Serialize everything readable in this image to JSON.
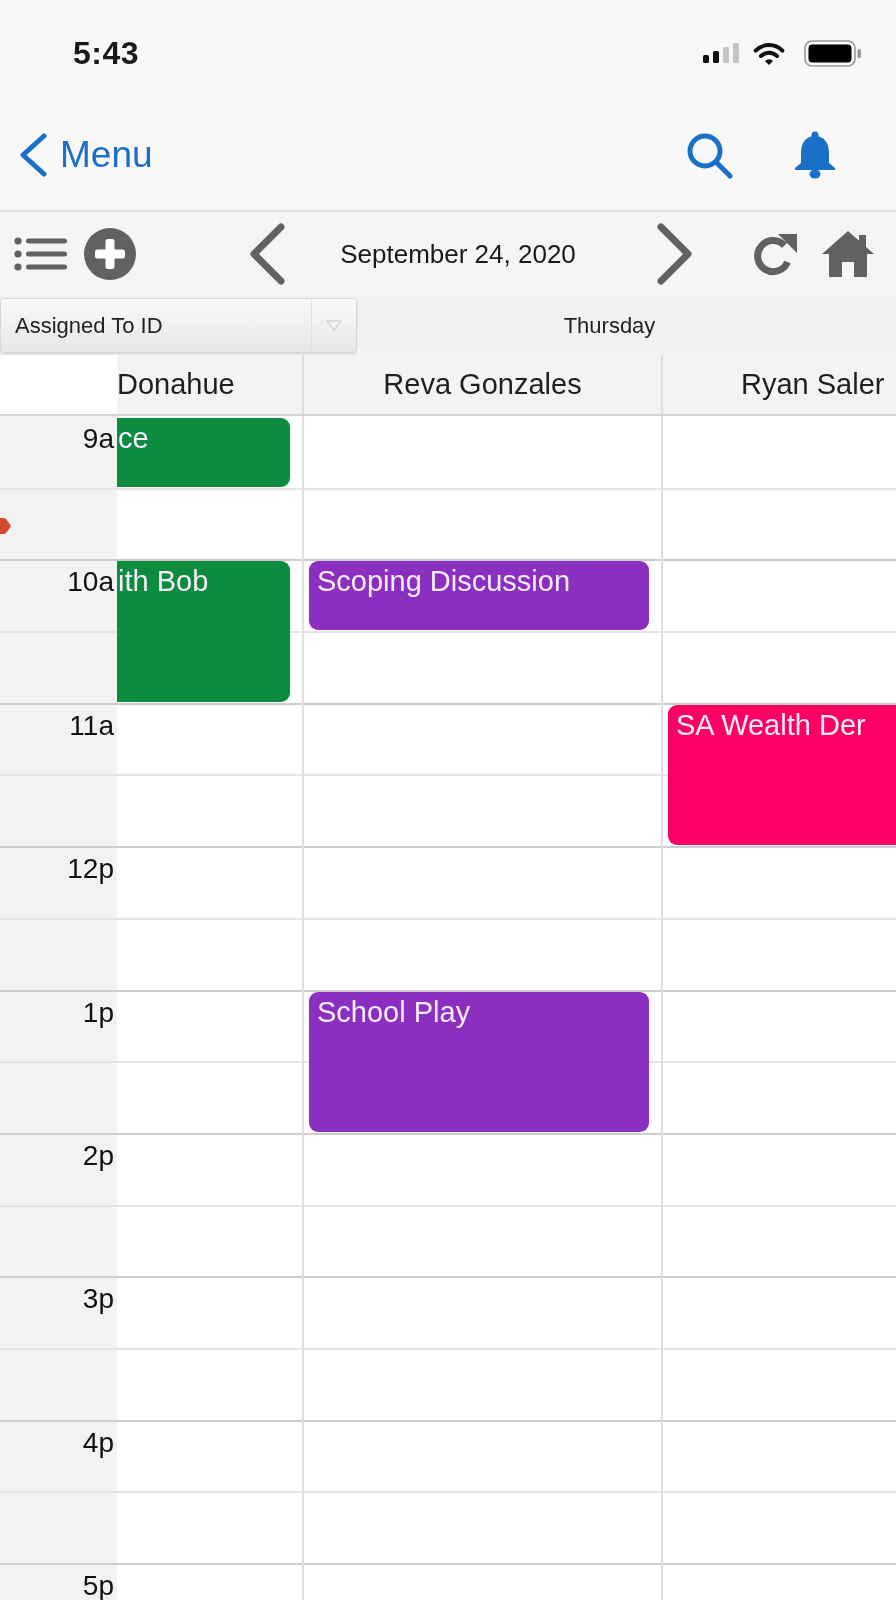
{
  "status_bar": {
    "time": "5:43"
  },
  "nav_bar": {
    "back_label": "Menu"
  },
  "toolbar": {
    "date": "September 24, 2020"
  },
  "filter": {
    "value": "Assigned To ID"
  },
  "calendar": {
    "day": "Thursday",
    "hours": [
      "9a",
      "10a",
      "11a",
      "12p",
      "1p",
      "2p",
      "3p",
      "4p",
      "5p"
    ],
    "columns": [
      {
        "name": "Donahue",
        "slots": [
          {
            "kind": "event",
            "title": "ce",
            "color": "#0b8c3f"
          },
          {
            "kind": "empty"
          },
          {
            "kind": "event",
            "title": "ith Bob",
            "color": "#0b8c3f"
          },
          {
            "kind": "continued"
          }
        ]
      },
      {
        "name": "Reva Gonzales",
        "slots": [
          {
            "kind": "empty"
          },
          {
            "kind": "empty"
          },
          {
            "kind": "event",
            "title": "Scoping Discussion",
            "color": "#8b2fc1"
          },
          {
            "kind": "empty"
          },
          {
            "kind": "empty"
          },
          {
            "kind": "empty"
          },
          {
            "kind": "empty"
          },
          {
            "kind": "empty"
          },
          {
            "kind": "event",
            "title": "School Play",
            "color": "#8b2fc1"
          },
          {
            "kind": "continued"
          }
        ]
      },
      {
        "name": "Ryan Saler",
        "slots": [
          {
            "kind": "empty"
          },
          {
            "kind": "empty"
          },
          {
            "kind": "empty"
          },
          {
            "kind": "empty"
          },
          {
            "kind": "event",
            "title": "SA Wealth Der",
            "color": "#fe0064"
          },
          {
            "kind": "continued"
          }
        ]
      }
    ]
  }
}
